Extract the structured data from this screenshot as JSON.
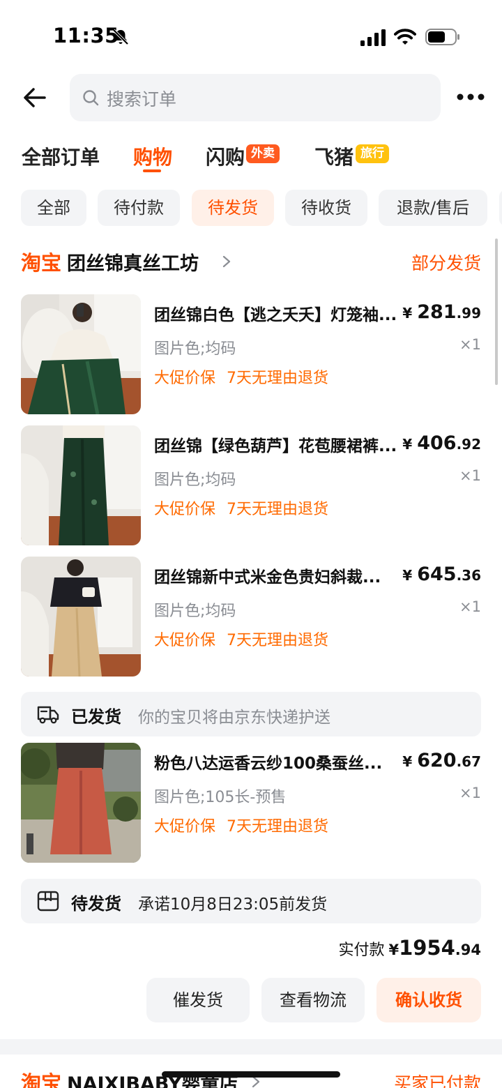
{
  "status_bar": {
    "time": "11:35",
    "icons": [
      "bell-off-icon",
      "signal-icon",
      "wifi-icon",
      "battery-icon"
    ]
  },
  "header": {
    "search_placeholder": "搜索订单",
    "icons": [
      "back-arrow-icon",
      "search-icon",
      "more-icon"
    ]
  },
  "category_tabs": [
    {
      "label": "全部订单",
      "active": false
    },
    {
      "label": "购物",
      "active": true
    },
    {
      "label": "闪购",
      "badge": "外卖",
      "active": false
    },
    {
      "label": "飞猪",
      "badge": "旅行",
      "active": false
    }
  ],
  "filters": [
    {
      "label": "全部",
      "active": false
    },
    {
      "label": "待付款",
      "active": false
    },
    {
      "label": "待发货",
      "active": true
    },
    {
      "label": "待收货",
      "active": false
    },
    {
      "label": "退款/售后",
      "active": false
    }
  ],
  "order": {
    "platform": "淘宝",
    "shop_name": "团丝锦真丝工坊",
    "status": "部分发货",
    "products": [
      {
        "title": "团丝锦白色【逃之夭夭】灯笼袖...",
        "price_symbol": "¥",
        "price_int": "281",
        "price_dec": ".99",
        "spec": "图片色;均码",
        "qty": "×1",
        "tags": [
          "大促价保",
          "7天无理由退货"
        ]
      },
      {
        "title": "团丝锦【绿色葫芦】花苞腰裙裤...",
        "price_symbol": "¥",
        "price_int": "406",
        "price_dec": ".92",
        "spec": "图片色;均码",
        "qty": "×1",
        "tags": [
          "大促价保",
          "7天无理由退货"
        ]
      },
      {
        "title": "团丝锦新中式米金色贵妇斜裁...",
        "price_symbol": "¥",
        "price_int": "645",
        "price_dec": ".36",
        "spec": "图片色;均码",
        "qty": "×1",
        "tags": [
          "大促价保",
          "7天无理由退货"
        ]
      }
    ],
    "shipped_bar": {
      "label": "已发货",
      "text": "你的宝贝将由京东快递护送"
    },
    "shipped_product": {
      "title": "粉色八达运香云纱100桑蚕丝...",
      "price_symbol": "¥",
      "price_int": "620",
      "price_dec": ".67",
      "spec": "图片色;105长-预售",
      "qty": "×1",
      "tags": [
        "大促价保",
        "7天无理由退货"
      ]
    },
    "pending_bar": {
      "label": "待发货",
      "text": "承诺10月8日23:05前发货"
    },
    "total": {
      "label": "实付款",
      "symbol": "¥",
      "int": "1954",
      "dec": ".94"
    },
    "actions": [
      {
        "label": "催发货",
        "primary": false
      },
      {
        "label": "查看物流",
        "primary": false
      },
      {
        "label": "确认收货",
        "primary": true
      }
    ]
  },
  "next_order": {
    "platform": "淘宝",
    "shop_name": "NAIXIBABY婴童店",
    "status": "买家已付款"
  },
  "colors": {
    "accent": "#ff5000",
    "tag": "#ff6a00",
    "muted": "#8a8d93",
    "chip_bg": "#f3f4f6",
    "chip_active_bg": "#fff0e8"
  }
}
